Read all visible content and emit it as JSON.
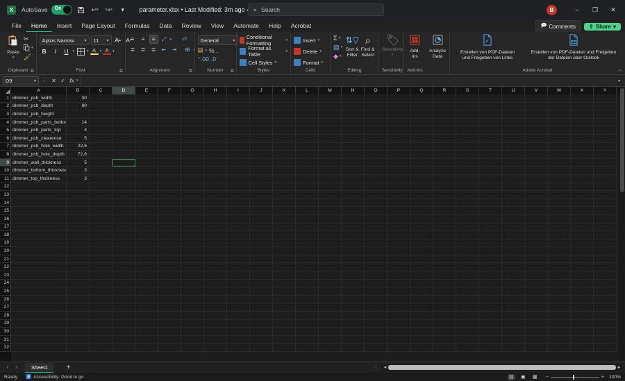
{
  "titlebar": {
    "app_icon": "excel-logo",
    "autosave_label": "AutoSave",
    "autosave_state": "On",
    "save_icon": "save-icon",
    "undo_icon": "undo-icon",
    "redo_icon": "redo-icon",
    "customize_icon": "customize-quick-access-icon",
    "document_title": "parameter.xlsx • Last Modified: 3m ago",
    "title_chevron": "chevron-down-icon",
    "avatar_initial": "B",
    "minimize": "–",
    "restore": "❐",
    "close": "✕"
  },
  "search": {
    "placeholder": "Search",
    "icon": "search-icon"
  },
  "ribbon_tabs": [
    {
      "label": "File",
      "active": false
    },
    {
      "label": "Home",
      "active": true
    },
    {
      "label": "Insert",
      "active": false
    },
    {
      "label": "Page Layout",
      "active": false
    },
    {
      "label": "Formulas",
      "active": false
    },
    {
      "label": "Data",
      "active": false
    },
    {
      "label": "Review",
      "active": false
    },
    {
      "label": "View",
      "active": false
    },
    {
      "label": "Automate",
      "active": false
    },
    {
      "label": "Help",
      "active": false
    },
    {
      "label": "Acrobat",
      "active": false
    }
  ],
  "tabs_right": {
    "comments_label": "Comments",
    "comments_icon": "comment-icon",
    "share_label": "Share",
    "share_icon": "share-icon",
    "share_chevron": "chevron-down-icon"
  },
  "ribbon": {
    "clipboard": {
      "group_label": "Clipboard",
      "paste_label": "Paste",
      "paste_icon": "paste-icon",
      "paste_chevron": "chevron-down-icon",
      "cut_icon": "scissors-icon",
      "copy_icon": "copy-icon",
      "copy_chevron": "chevron-down-icon",
      "format_painter_icon": "format-painter-icon",
      "dialog_launcher": "dialog-launcher-icon"
    },
    "font": {
      "group_label": "Font",
      "font_name": "Aptos Narrow",
      "font_size": "11",
      "grow_font": "A",
      "shrink_font": "A",
      "bold": "B",
      "italic": "I",
      "underline": "U",
      "underline_chevron": "chevron-down-icon",
      "borders_icon": "borders-icon",
      "borders_chevron": "chevron-down-icon",
      "fill_color_icon": "fill-color-icon",
      "fill_color_chevron": "chevron-down-icon",
      "font_color_icon": "font-color-icon",
      "font_color_chevron": "chevron-down-icon",
      "fill_swatch": "#ffd966",
      "font_swatch": "#c0392b",
      "dialog_launcher": "dialog-launcher-icon"
    },
    "alignment": {
      "group_label": "Alignment",
      "align_top": "align-top-icon",
      "align_middle": "align-middle-icon",
      "align_bottom": "align-bottom-icon",
      "orientation_icon": "text-orientation-icon",
      "orientation_chevron": "chevron-down-icon",
      "align_left": "align-left-icon",
      "align_center": "align-center-icon",
      "align_right": "align-right-icon",
      "decrease_indent": "decrease-indent-icon",
      "increase_indent": "increase-indent-icon",
      "wrap_text_icon": "wrap-text-icon",
      "merge_center_icon": "merge-and-center-icon",
      "merge_chevron": "chevron-down-icon",
      "dialog_launcher": "dialog-launcher-icon"
    },
    "number": {
      "group_label": "Number",
      "format_value": "General",
      "format_chevron": "chevron-down-icon",
      "accounting_icon": "accounting-format-icon",
      "accounting_chevron": "chevron-down-icon",
      "percent_icon": "%",
      "comma_icon": "comma-style-icon",
      "increase_decimal": "increase-decimal-icon",
      "decrease_decimal": "decrease-decimal-icon",
      "dialog_launcher": "dialog-launcher-icon"
    },
    "styles": {
      "group_label": "Styles",
      "conditional_formatting": "Conditional Formatting",
      "conditional_icon": "conditional-formatting-icon",
      "format_as_table": "Format as Table",
      "table_icon": "format-as-table-icon",
      "cell_styles": "Cell Styles",
      "cell_styles_icon": "cell-styles-icon",
      "chevron": "chevron-down-icon"
    },
    "cells": {
      "group_label": "Cells",
      "insert_label": "Insert",
      "insert_icon": "insert-cells-icon",
      "delete_label": "Delete",
      "delete_icon": "delete-cells-icon",
      "format_label": "Format",
      "format_icon": "format-cells-icon",
      "chevron": "chevron-down-icon"
    },
    "editing": {
      "group_label": "Editing",
      "autosum_icon": "sigma-icon",
      "fill_icon": "fill-icon",
      "clear_icon": "eraser-icon",
      "sort_filter_label": "Sort & Filter",
      "sort_filter_icon": "sort-filter-icon",
      "find_select_label": "Find & Select",
      "find_select_icon": "magnifier-icon",
      "chevron": "chevron-down-icon"
    },
    "sensitivity": {
      "group_label": "Sensitivity",
      "label": "Sensitivity",
      "icon": "sensitivity-icon",
      "chevron": "chevron-down-icon"
    },
    "addins": {
      "group_label": "Add-ins",
      "label": "Add-ins",
      "icon": "add-ins-icon"
    },
    "analyze": {
      "group_label": "",
      "label": "Analyze Data",
      "icon": "analyze-data-icon"
    },
    "acrobat": {
      "group_label": "Adobe Acrobat",
      "button1": "Erstellen von PDF-Dateien und Freigeben von Links",
      "button1_icon": "create-pdf-share-link-icon",
      "button2": "Erstellen von PDF-Dateien und Freigeben der Dateien über Outlook",
      "button2_icon": "create-pdf-share-outlook-icon",
      "collapse_icon": "collapse-ribbon-icon"
    }
  },
  "formula_bar": {
    "name_box_value": "D9",
    "name_box_chevron": "chevron-down-icon",
    "menu_dots": "more-options-icon",
    "cancel_icon": "✕",
    "enter_icon": "✓",
    "function_icon": "fx",
    "function_chevron": "chevron-down-icon",
    "formula_value": "",
    "expand_icon": "expand-formula-bar-icon"
  },
  "grid": {
    "columns": [
      "A",
      "B",
      "C",
      "D",
      "E",
      "F",
      "G",
      "H",
      "I",
      "J",
      "K",
      "L",
      "M",
      "N",
      "O",
      "P",
      "Q",
      "R",
      "S",
      "T",
      "U",
      "V",
      "W",
      "X",
      "Y"
    ],
    "selected_column": "D",
    "selected_row": 9,
    "active_cell": "D9",
    "rows": [
      {
        "n": 1,
        "a": "dimmer_pcb_width",
        "b": "30"
      },
      {
        "n": 2,
        "a": "dimmer_pcb_depth",
        "b": "80"
      },
      {
        "n": 3,
        "a": "dimmer_pcb_height",
        "b": ""
      },
      {
        "n": 4,
        "a": "dimmer_pcb_parts_bottom",
        "b": "14"
      },
      {
        "n": 5,
        "a": "dimmer_pcb_parts_top",
        "b": "4"
      },
      {
        "n": 6,
        "a": "dimmer_pcb_clearence",
        "b": "5"
      },
      {
        "n": 7,
        "a": "dimmer_pcb_hole_width",
        "b": "22,6"
      },
      {
        "n": 8,
        "a": "dimmer_pcb_hole_depth",
        "b": "72,6"
      },
      {
        "n": 9,
        "a": "dimmer_wall_thickness",
        "b": "5"
      },
      {
        "n": 10,
        "a": "dimmer_bottom_thickness",
        "b": "3"
      },
      {
        "n": 11,
        "a": "dimmer_top_thickness",
        "b": "3"
      },
      {
        "n": 12,
        "a": "",
        "b": ""
      },
      {
        "n": 13,
        "a": "",
        "b": ""
      },
      {
        "n": 14,
        "a": "",
        "b": ""
      },
      {
        "n": 15,
        "a": "",
        "b": ""
      },
      {
        "n": 16,
        "a": "",
        "b": ""
      },
      {
        "n": 17,
        "a": "",
        "b": ""
      },
      {
        "n": 18,
        "a": "",
        "b": ""
      },
      {
        "n": 19,
        "a": "",
        "b": ""
      },
      {
        "n": 20,
        "a": "",
        "b": ""
      },
      {
        "n": 21,
        "a": "",
        "b": ""
      },
      {
        "n": 22,
        "a": "",
        "b": ""
      },
      {
        "n": 23,
        "a": "",
        "b": ""
      },
      {
        "n": 24,
        "a": "",
        "b": ""
      },
      {
        "n": 25,
        "a": "",
        "b": ""
      },
      {
        "n": 26,
        "a": "",
        "b": ""
      },
      {
        "n": 27,
        "a": "",
        "b": ""
      },
      {
        "n": 28,
        "a": "",
        "b": ""
      },
      {
        "n": 29,
        "a": "",
        "b": ""
      },
      {
        "n": 30,
        "a": "",
        "b": ""
      },
      {
        "n": 31,
        "a": "",
        "b": ""
      },
      {
        "n": 32,
        "a": "",
        "b": ""
      }
    ]
  },
  "sheetbar": {
    "prev_icon": "previous-sheet-icon",
    "next_icon": "next-sheet-icon",
    "sheets": [
      {
        "name": "Sheet1",
        "active": true
      }
    ],
    "add_sheet_icon": "+",
    "scroll_dots": "sheet-tab-splitter-icon",
    "left_arrow": "◄",
    "right_arrow": "►"
  },
  "statusbar": {
    "mode": "Ready",
    "accessibility_icon": "accessibility-icon",
    "accessibility_text": "Accessibility: Good to go",
    "view_normal_icon": "normal-view-icon",
    "view_pagelayout_icon": "page-layout-view-icon",
    "view_pagebreak_icon": "page-break-preview-icon",
    "zoom_out": "−",
    "zoom_in": "+",
    "zoom_level": "100%"
  },
  "colors": {
    "accent_green": "#217346",
    "share_green": "#4fd28b",
    "avatar_red": "#c0392b",
    "selection_border": "#4c8a5e",
    "ribbon_bg": "#262626",
    "grid_bg": "#1d1d1d"
  }
}
